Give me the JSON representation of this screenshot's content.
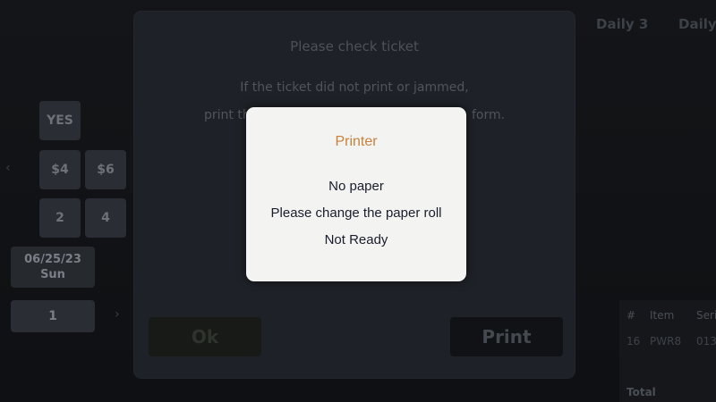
{
  "background": {
    "tabs": [
      "Daily 3",
      "Daily"
    ],
    "right_subtitle": "",
    "keys_row1": [
      "YES"
    ],
    "keys_row2": [
      "$4",
      "$6"
    ],
    "keys_row3": [
      "2",
      "4"
    ],
    "date": {
      "line1": "06/25/23",
      "line2": "Sun"
    },
    "quantity": "1",
    "ticket_table": {
      "headers": [
        "#",
        "Item",
        "Seri"
      ],
      "row": [
        "16",
        "PWR8",
        "013"
      ],
      "total_label": "Total"
    }
  },
  "outer_dialog": {
    "title": "Please check ticket",
    "line1": "If the ticket did not print or jammed,",
    "line2_left": "print th",
    "line2_right": "form.",
    "ok_label": "Ok",
    "print_label": "Print"
  },
  "alert": {
    "title": "Printer",
    "messages": [
      "No paper",
      "Please change the paper roll",
      "Not Ready"
    ],
    "title_color": "#c8823c",
    "text_color": "#1a1d2c"
  }
}
